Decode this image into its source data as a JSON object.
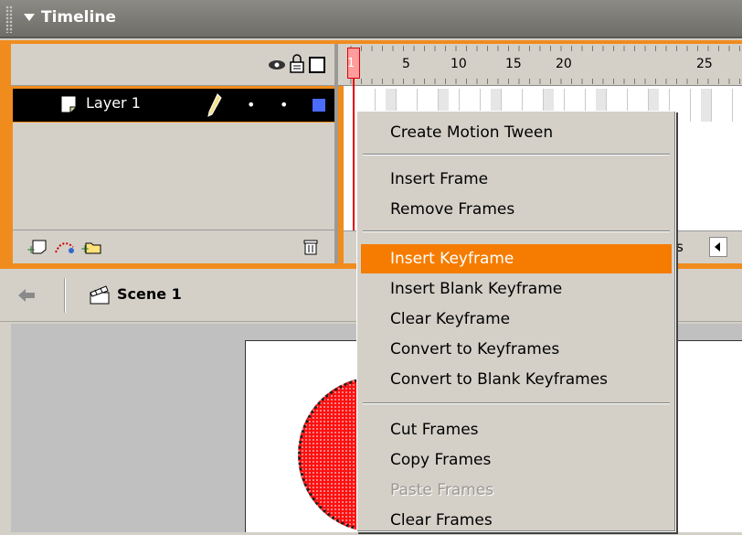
{
  "window": {
    "title": "Timeline"
  },
  "ruler": {
    "ticks": [
      "1",
      "5",
      "10",
      "15",
      "20",
      "25"
    ]
  },
  "layers": [
    {
      "name": "Layer 1",
      "selected": true
    }
  ],
  "stage": {
    "scene_label": "Scene 1"
  },
  "context_menu": {
    "groups": [
      [
        "Create Motion Tween"
      ],
      [
        "Insert Frame",
        "Remove Frames"
      ],
      [
        "Insert Keyframe",
        "Insert Blank Keyframe",
        "Clear Keyframe",
        "Convert to Keyframes",
        "Convert to Blank Keyframes"
      ],
      [
        "Cut Frames",
        "Copy Frames",
        "Paste Frames",
        "Clear Frames"
      ]
    ],
    "highlighted": "Insert Keyframe",
    "disabled": [
      "Paste Frames"
    ]
  },
  "colors": {
    "accent": "#f57c00",
    "panel_border": "#f08c1e",
    "playhead": "#e00000",
    "circle_fill": "#ff1010"
  },
  "footer": {
    "truncated_label": "s"
  }
}
